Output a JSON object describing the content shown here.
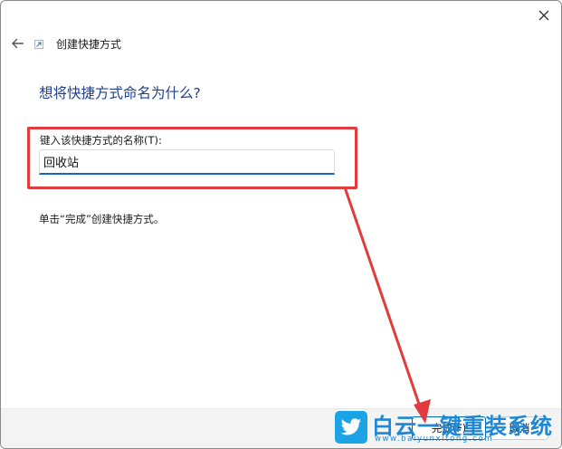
{
  "window": {
    "title": "创建快捷方式"
  },
  "main": {
    "heading": "想将快捷方式命名为什么?",
    "field_label": "键入该快捷方式的名称(T):",
    "name_value": "回收站",
    "hint": "单击“完成”创建快捷方式。"
  },
  "footer": {
    "finish_label": "完成(F)",
    "cancel_label": "取消"
  },
  "annotation": {
    "color": "#e23b3b"
  },
  "watermark": {
    "text": "白云一键重装系统",
    "sub": "www.baiyunxitong.com"
  },
  "icons": [
    "close-icon",
    "back-arrow-icon",
    "shortcut-icon",
    "twitter-bird-icon"
  ],
  "colors": {
    "heading": "#1e3f8f",
    "input_underline": "#1666c4",
    "footer_bg": "#f3f3f3",
    "watermark": "#1e88d6"
  }
}
